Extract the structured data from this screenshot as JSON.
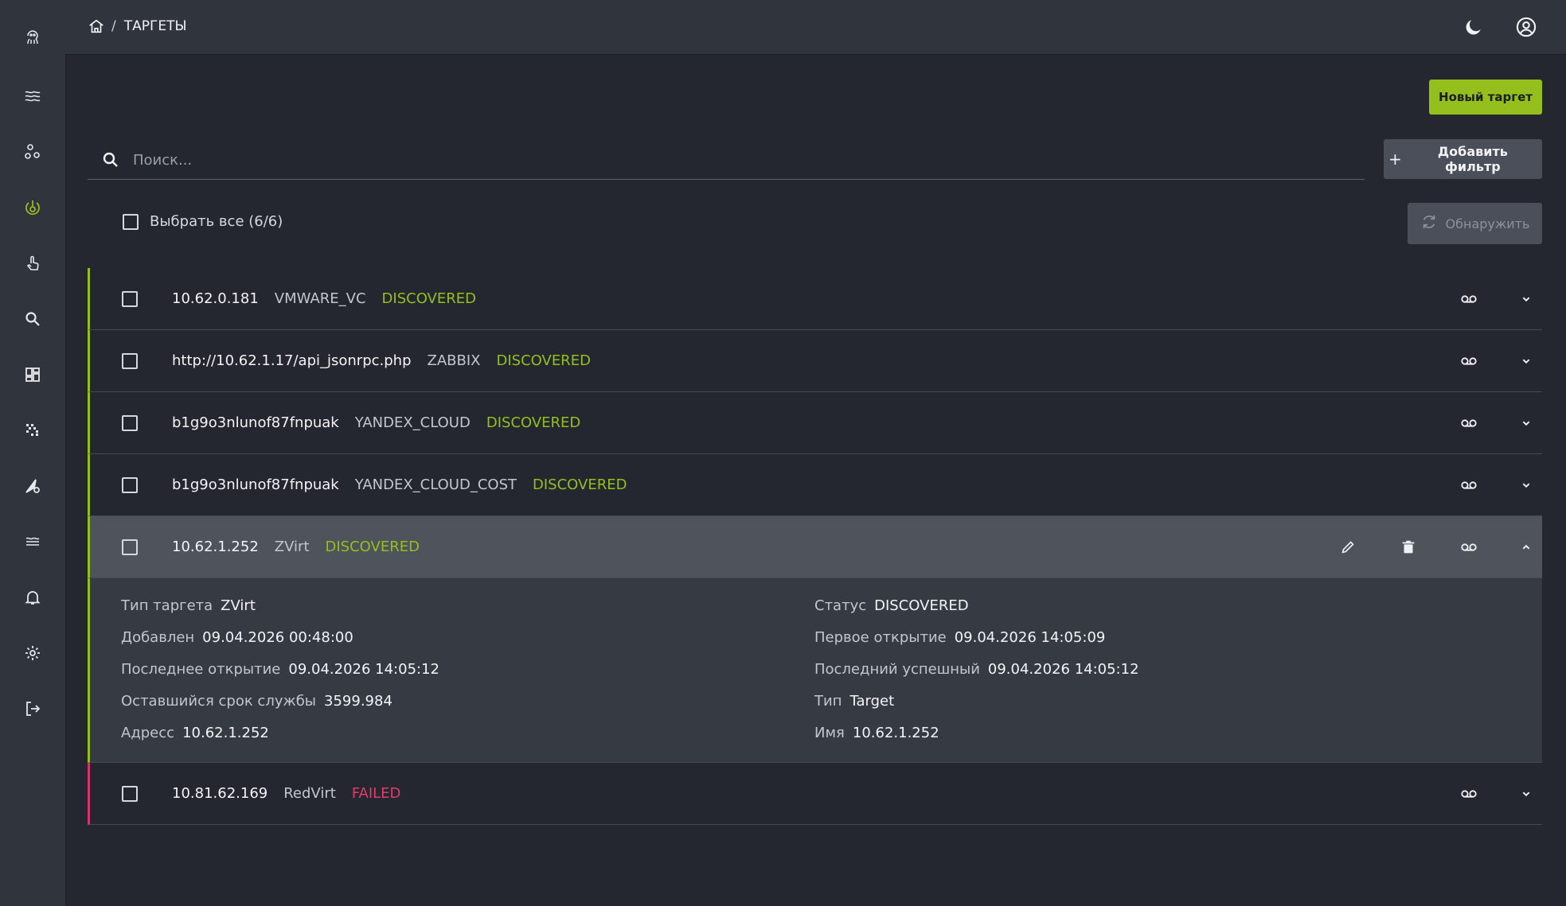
{
  "sidebar": {
    "icons": [
      "octopus-logo-icon",
      "layers-icon",
      "nodes-icon",
      "targets-icon",
      "touch-icon",
      "search-icon",
      "dashboard-icon",
      "matrix-icon",
      "tools-icon",
      "streams-icon",
      "bell-icon",
      "gear-icon",
      "logout-icon"
    ],
    "active_icon": "targets-icon",
    "accent_color": "#95bf1c"
  },
  "header": {
    "breadcrumb_sep": "/",
    "breadcrumb_current": "ТАРГЕТЫ"
  },
  "toolbar": {
    "new_target_label": "Новый таргет",
    "search_placeholder": "Поиск...",
    "add_filter_label": "Добавить фильтр",
    "select_all_label": "Выбрать все (6/6)",
    "discover_label": "Обнаружить"
  },
  "targets": [
    {
      "name": "10.62.0.181",
      "type": "VMWARE_VC",
      "status": "DISCOVERED"
    },
    {
      "name": "http://10.62.1.17/api_jsonrpc.php",
      "type": "ZABBIX",
      "status": "DISCOVERED"
    },
    {
      "name": "b1g9o3nlunof87fnpuak",
      "type": "YANDEX_CLOUD",
      "status": "DISCOVERED"
    },
    {
      "name": "b1g9o3nlunof87fnpuak",
      "type": "YANDEX_CLOUD_COST",
      "status": "DISCOVERED"
    },
    {
      "name": "10.62.1.252",
      "type": "ZVirt",
      "status": "DISCOVERED"
    },
    {
      "name": "10.81.62.169",
      "type": "RedVirt",
      "status": "FAILED"
    }
  ],
  "details": {
    "left": [
      {
        "label": "Тип таргета",
        "value": "ZVirt"
      },
      {
        "label": "Добавлен",
        "value": "09.04.2026 00:48:00"
      },
      {
        "label": "Последнее открытие",
        "value": "09.04.2026 14:05:12"
      },
      {
        "label": "Оставшийся срок службы",
        "value": "3599.984"
      },
      {
        "label": "Адресс",
        "value": "10.62.1.252"
      }
    ],
    "right": [
      {
        "label": "Статус",
        "value": "DISCOVERED"
      },
      {
        "label": "Первое открытие",
        "value": "09.04.2026 14:05:09"
      },
      {
        "label": "Последний успешный",
        "value": "09.04.2026 14:05:12"
      },
      {
        "label": "Тип",
        "value": "Target"
      },
      {
        "label": "Имя",
        "value": "10.62.1.252"
      }
    ]
  },
  "colors": {
    "ok": "#95bf1c",
    "fail": "#e03b6e"
  }
}
